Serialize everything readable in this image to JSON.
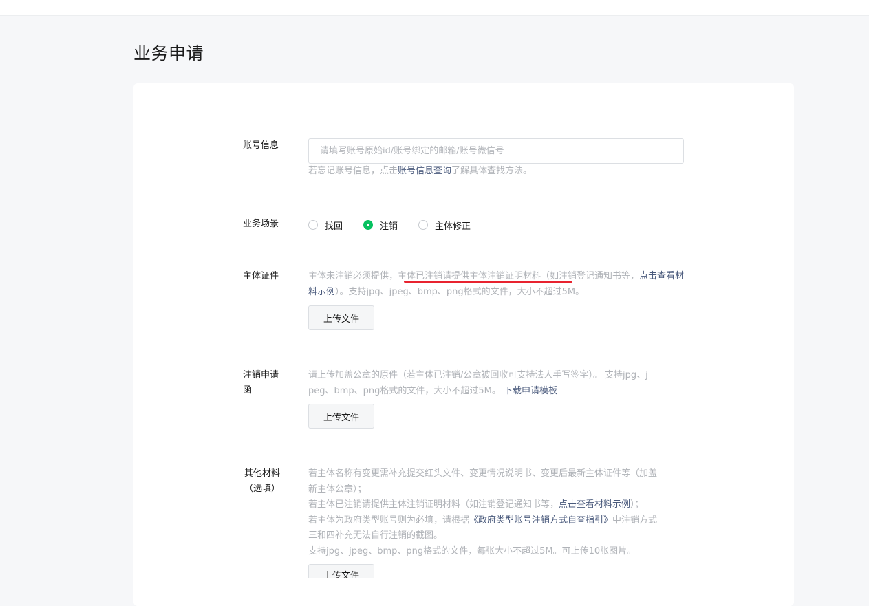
{
  "page": {
    "title": "业务申请"
  },
  "account": {
    "label": "账号信息",
    "placeholder": "请填写账号原始id/账号绑定的邮箱/账号微信号",
    "hint_prefix": "若忘记账号信息，点击",
    "hint_link": "账号信息查询",
    "hint_suffix": "了解具体查找方法。"
  },
  "scenario": {
    "label": "业务场景",
    "options": [
      {
        "label": "找回",
        "checked": false
      },
      {
        "label": "注销",
        "checked": true
      },
      {
        "label": "主体修正",
        "checked": false
      }
    ]
  },
  "certificate": {
    "label": "主体证件",
    "hint_part1": "主体未注销必须提供，",
    "hint_part2": "主体已注销请提供主体注销证明材料（如注销登记通知书等，",
    "hint_link": "点击查看材料示例",
    "hint_part3": "）。支持jpg、jpeg、bmp、png格式的文件，大小不超过5M。",
    "upload_label": "上传文件"
  },
  "cancel_letter": {
    "label_line1": "注销申请",
    "label_line2": "函",
    "hint_line1": "请上传加盖公章的原件（若主体已注销/公章被回收可支持法人手写签字）。 支持jpg、j",
    "hint_line2_prefix": "peg、bmp、png格式的文件，大小不超过5M。",
    "hint_link": "下载申请模板",
    "upload_label": "上传文件"
  },
  "other": {
    "label_line1": "其他材料",
    "label_line2": "（选填）",
    "hint_l1": "若主体名称有变更需补充提交红头文件、变更情况说明书、变更后最新主体证件等（加盖",
    "hint_l2": "新主体公章）；",
    "hint_l3_prefix": "若主体已注销请提供主体注销证明材料（如注销登记通知书等，",
    "hint_l3_link": "点击查看材料示例",
    "hint_l3_suffix": "）；",
    "hint_l4_prefix": "若主体为政府类型账号则为必填，请根据",
    "hint_l4_link": "《政府类型账号注销方式自查指引》",
    "hint_l4_suffix": "中注销方式",
    "hint_l5": "三和四补充无法自行注销的截图。",
    "hint_l6": "支持jpg、jpeg、bmp、png格式的文件，每张大小不超过5M。可上传10张图片。",
    "upload_label": "上传文件"
  }
}
